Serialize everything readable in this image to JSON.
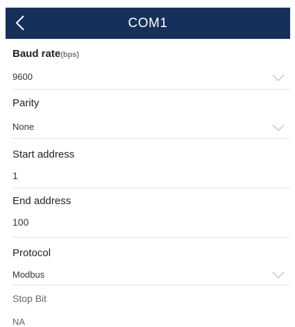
{
  "header": {
    "title": "COM1"
  },
  "fields": {
    "baud_rate": {
      "label": "Baud rate",
      "unit": "(bps)",
      "value": "9600"
    },
    "parity": {
      "label": "Parity",
      "value": "None"
    },
    "start_address": {
      "label": "Start address",
      "value": "1"
    },
    "end_address": {
      "label": "End address",
      "value": "100"
    },
    "protocol": {
      "label": "Protocol",
      "value": "Modbus"
    },
    "stop_bit": {
      "label": "Stop Bit",
      "value": "NA"
    }
  },
  "icons": {
    "back": "chevron-left-icon",
    "dropdown": "chevron-down-icon"
  },
  "colors": {
    "header_bg": "#15305a",
    "header_text": "#ffffff",
    "divider": "#e3e3e3"
  }
}
